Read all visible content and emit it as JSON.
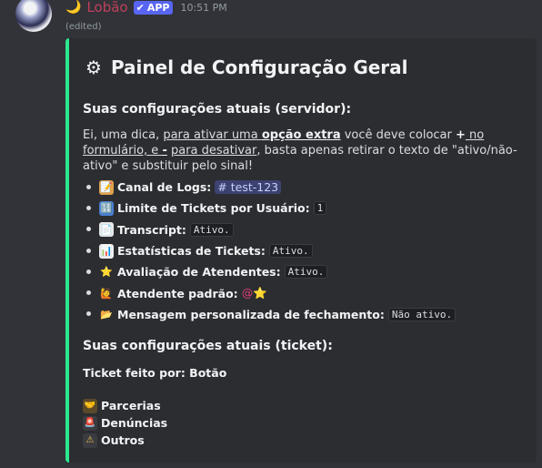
{
  "header": {
    "moon": "🌙",
    "username": "Lobão",
    "badge": "APP",
    "badge_check": "✔",
    "timestamp": "10:51 PM",
    "edited": "(edited)"
  },
  "embed": {
    "accent_color": "#2ce891",
    "gear": "⚙",
    "title": "Painel de Configuração Geral",
    "server_heading": "Suas configurações atuais (servidor):",
    "tip": {
      "p1": "Ei, uma dica, ",
      "p2": "para ativar uma ",
      "p3": "opção extra",
      "p4": " você deve colocar ",
      "p5": "+",
      "p6": " no formulário, e ",
      "p7": "-",
      "p8": "para desativar",
      "p9": ", basta apenas retirar o texto de \"ativo/não-ativo\" e substituir pelo sinal!"
    },
    "settings": [
      {
        "icon": "📝",
        "label": "Canal de Logs:",
        "value": "# test-123",
        "kind": "channel"
      },
      {
        "icon": "🔢",
        "label": "Limite de Tickets por Usuário:",
        "value": "1",
        "kind": "code"
      },
      {
        "icon": "📄",
        "label": "Transcript:",
        "value": "Ativo.",
        "kind": "code"
      },
      {
        "icon": "📊",
        "label": "Estatísticas de Tickets:",
        "value": "Ativo.",
        "kind": "code"
      },
      {
        "icon": "⭐",
        "label": "Avaliação de Atendentes:",
        "value": "Ativo.",
        "kind": "code"
      },
      {
        "icon": "🙋",
        "label": "Atendente padrão:",
        "value": "@⭐",
        "kind": "mention"
      },
      {
        "icon": "📂",
        "label": "Mensagem personalizada de fechamento:",
        "value": "Não ativo.",
        "kind": "code"
      }
    ],
    "ticket_heading": "Suas configurações atuais (ticket):",
    "ticket_by": "Ticket feito por: Botão",
    "categories": [
      {
        "icon": "🤝",
        "label": "Parcerias"
      },
      {
        "icon": "🚨",
        "label": "Denúncias"
      },
      {
        "icon": "⚠",
        "label": "Outros"
      }
    ]
  }
}
